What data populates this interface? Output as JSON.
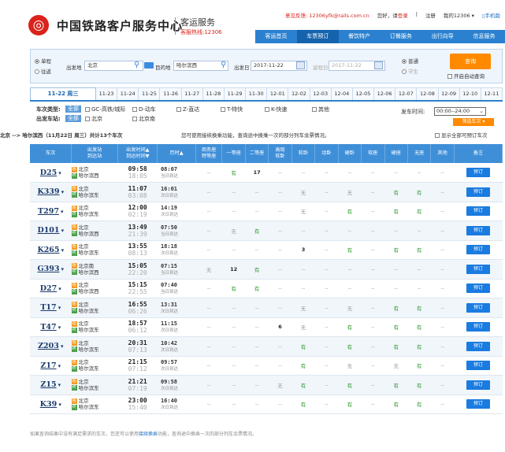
{
  "header": {
    "logo_glyph": "◎",
    "site_name": "中国铁路客户服务中心",
    "sub_title": "客运服务",
    "hotline": "客服热线:12306",
    "top_links": [
      "意见反馈: 12306yfk@rails.com.cn",
      "您好，请",
      "登录",
      "|",
      "注册",
      "我的12306 ▾",
      "手机版"
    ]
  },
  "nav": [
    "客运首页",
    "车票预订",
    "餐饮特产",
    "订餐服务",
    "出行向导",
    "信息服务"
  ],
  "search": {
    "trip_one_way": "单程",
    "trip_round": "往返",
    "from_label": "出发地",
    "from_value": "北京",
    "to_label": "目的地",
    "to_value": "哈尔滨西",
    "depart_label": "出发日",
    "depart_value": "2017-11-22",
    "return_label": "返程日",
    "return_value": "2017-11-22",
    "type_normal": "普通",
    "type_student": "学生",
    "query_label": "查询",
    "auto_query": "开启自动查询"
  },
  "date_tabs": {
    "main": "11-22 周三",
    "dates": [
      "11-23",
      "11-24",
      "11-25",
      "11-26",
      "11-27",
      "11-28",
      "11-29",
      "11-30",
      "12-01",
      "12-02",
      "12-03",
      "12-04",
      "12-05",
      "12-06",
      "12-07",
      "12-08",
      "12-09",
      "12-10",
      "12-11"
    ]
  },
  "filters": {
    "type_label": "车次类型:",
    "station_label": "出发车站:",
    "all": "全部",
    "types": [
      "GC-高铁/城际",
      "D-动车",
      "Z-直达",
      "T-特快",
      "K-快速",
      "其他"
    ],
    "stations": [
      "北京",
      "北京南"
    ],
    "depart_time_label": "发车时间:",
    "depart_time_value": "00:00--24:00",
    "filter_btn": "筛选车次 ▾"
  },
  "summary": {
    "route": "北京 --> 哈尔滨西（11月22日 周三）共计13个车次",
    "tip": "您可使用接续换乘功能，查询途中换乘一次的部分列车余票情况。",
    "show_all_label": "显示全部可预订车次"
  },
  "table": {
    "headers": [
      "车次",
      "出发站\n到达站",
      "出发时间▲\n到达时间▼",
      "历时▲",
      "商务座\n特等座",
      "一等座",
      "二等座",
      "高级\n软卧",
      "软卧",
      "动卧",
      "硬卧",
      "软座",
      "硬座",
      "无座",
      "其他",
      "备注"
    ],
    "start_tag": "始",
    "end_tag": "终",
    "book_label": "预订",
    "rows": [
      {
        "train": "D25",
        "from": "北京",
        "to": "哈尔滨西",
        "dep": "09:58",
        "arr": "18:05",
        "dur": "08:07",
        "day": "当日到达",
        "seats": [
          "--",
          "有",
          "17",
          "--",
          "--",
          "--",
          "--",
          "--",
          "--",
          "--",
          "--"
        ]
      },
      {
        "train": "K339",
        "from": "北京",
        "to": "哈尔滨东",
        "dep": "11:07",
        "arr": "03:08",
        "dur": "16:01",
        "day": "次日到达",
        "seats": [
          "--",
          "--",
          "--",
          "--",
          "无",
          "--",
          "无",
          "--",
          "有",
          "有",
          "--"
        ]
      },
      {
        "train": "T297",
        "from": "北京",
        "to": "哈尔滨东",
        "dep": "12:00",
        "arr": "02:19",
        "dur": "14:19",
        "day": "次日到达",
        "seats": [
          "--",
          "--",
          "--",
          "--",
          "无",
          "--",
          "有",
          "--",
          "有",
          "有",
          "--"
        ]
      },
      {
        "train": "D101",
        "from": "北京",
        "to": "哈尔滨西",
        "dep": "13:49",
        "arr": "21:39",
        "dur": "07:50",
        "day": "当日到达",
        "seats": [
          "--",
          "无",
          "有",
          "--",
          "--",
          "--",
          "--",
          "--",
          "--",
          "--",
          "--"
        ]
      },
      {
        "train": "K265",
        "from": "北京",
        "to": "哈尔滨东",
        "dep": "13:55",
        "arr": "08:13",
        "dur": "18:18",
        "day": "次日到达",
        "seats": [
          "--",
          "--",
          "--",
          "--",
          "3",
          "--",
          "有",
          "--",
          "有",
          "有",
          "--"
        ]
      },
      {
        "train": "G393",
        "from": "北京南",
        "to": "哈尔滨西",
        "dep": "15:05",
        "arr": "22:20",
        "dur": "07:15",
        "day": "当日到达",
        "seats": [
          "无",
          "12",
          "有",
          "--",
          "--",
          "--",
          "--",
          "--",
          "--",
          "--",
          "--"
        ]
      },
      {
        "train": "D27",
        "from": "北京",
        "to": "哈尔滨西",
        "dep": "15:15",
        "arr": "22:55",
        "dur": "07:40",
        "day": "当日到达",
        "seats": [
          "--",
          "有",
          "有",
          "--",
          "--",
          "--",
          "--",
          "--",
          "--",
          "--",
          "--"
        ]
      },
      {
        "train": "T17",
        "from": "北京",
        "to": "哈尔滨东",
        "dep": "16:55",
        "arr": "06:26",
        "dur": "13:31",
        "day": "次日到达",
        "seats": [
          "--",
          "--",
          "--",
          "--",
          "无",
          "--",
          "无",
          "--",
          "有",
          "有",
          "--"
        ]
      },
      {
        "train": "T47",
        "from": "北京",
        "to": "哈尔滨东",
        "dep": "18:57",
        "arr": "06:12",
        "dur": "11:15",
        "day": "次日到达",
        "seats": [
          "--",
          "--",
          "--",
          "6",
          "无",
          "--",
          "有",
          "--",
          "有",
          "有",
          "--"
        ]
      },
      {
        "train": "Z203",
        "from": "北京",
        "to": "哈尔滨东",
        "dep": "20:31",
        "arr": "07:13",
        "dur": "10:42",
        "day": "次日到达",
        "seats": [
          "--",
          "--",
          "--",
          "--",
          "有",
          "--",
          "有",
          "--",
          "有",
          "有",
          "--"
        ]
      },
      {
        "train": "Z17",
        "from": "北京",
        "to": "哈尔滨东",
        "dep": "21:15",
        "arr": "07:12",
        "dur": "09:57",
        "day": "次日到达",
        "seats": [
          "--",
          "--",
          "--",
          "--",
          "有",
          "--",
          "无",
          "--",
          "无",
          "有",
          "--"
        ]
      },
      {
        "train": "Z15",
        "from": "北京",
        "to": "哈尔滨东",
        "dep": "21:21",
        "arr": "07:19",
        "dur": "09:58",
        "day": "次日到达",
        "seats": [
          "--",
          "--",
          "--",
          "无",
          "有",
          "--",
          "有",
          "--",
          "有",
          "有",
          "--"
        ]
      },
      {
        "train": "K39",
        "from": "北京",
        "to": "哈尔滨东",
        "dep": "23:00",
        "arr": "15:40",
        "dur": "16:40",
        "day": "次日到达",
        "seats": [
          "--",
          "--",
          "--",
          "--",
          "有",
          "--",
          "有",
          "--",
          "有",
          "有",
          "--"
        ]
      }
    ]
  },
  "footer": {
    "note_before": "如果查询结果中没有满足需求的车次，您还可以使用",
    "note_link": "接续换乘",
    "note_after": "功能，查询途中换乘一次的部分列车余票情况。"
  },
  "colors": {
    "primary": "#2b81cf",
    "accent": "#ff8a00",
    "brand_red": "#d9231b",
    "available_green": "#2e9a2e"
  }
}
